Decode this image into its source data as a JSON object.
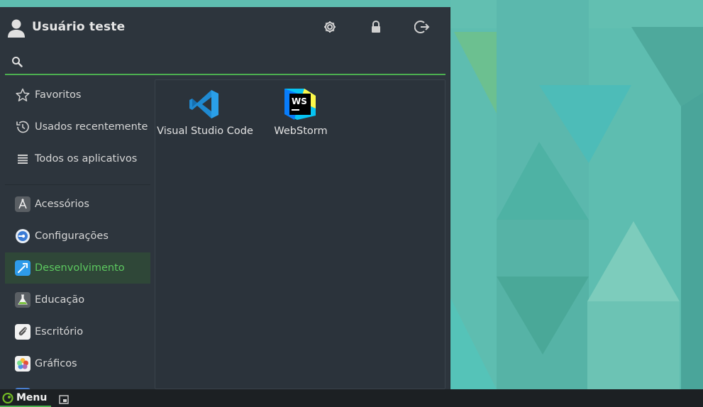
{
  "header": {
    "user_name": "Usuário teste",
    "icons": [
      "user-icon",
      "settings-icon",
      "lock-icon",
      "logout-icon"
    ]
  },
  "search": {
    "value": "",
    "placeholder": ""
  },
  "sidebar": {
    "items": [
      {
        "label": "Favoritos",
        "icon": "star-icon"
      },
      {
        "label": "Usados recentemente",
        "icon": "history-icon"
      },
      {
        "label": "Todos os aplicativos",
        "icon": "list-icon"
      },
      {
        "label": "Acessórios",
        "icon": "accessories-icon"
      },
      {
        "label": "Configurações",
        "icon": "settings-category-icon"
      },
      {
        "label": "Desenvolvimento",
        "icon": "development-icon",
        "active": true
      },
      {
        "label": "Educação",
        "icon": "education-icon"
      },
      {
        "label": "Escritório",
        "icon": "office-icon"
      },
      {
        "label": "Gráficos",
        "icon": "graphics-icon"
      }
    ]
  },
  "apps": [
    {
      "label": "Visual Studio Code",
      "icon": "vscode-icon"
    },
    {
      "label": "WebStorm",
      "icon": "webstorm-icon"
    }
  ],
  "taskbar": {
    "menu_label": "Menu"
  },
  "colors": {
    "accent": "#4caf50",
    "panel_bg": "#2d353d",
    "active_bg": "#2f4738",
    "active_text": "#5cc85f",
    "taskbar_bg": "#1c2023"
  }
}
